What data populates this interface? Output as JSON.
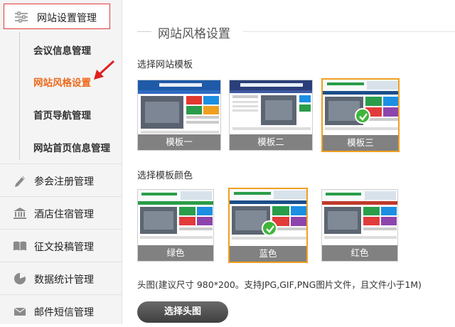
{
  "sidebar": {
    "top_item": {
      "label": "网站设置管理",
      "icon": "sliders-icon"
    },
    "sub_items": [
      {
        "label": "会议信息管理",
        "active": false
      },
      {
        "label": "网站风格设置",
        "active": true
      },
      {
        "label": "首页导航管理",
        "active": false
      },
      {
        "label": "网站首页信息管理",
        "active": false
      }
    ],
    "items": [
      {
        "label": "参会注册管理",
        "icon": "pencil-icon"
      },
      {
        "label": "酒店住宿管理",
        "icon": "bank-icon"
      },
      {
        "label": "征文投稿管理",
        "icon": "book-icon"
      },
      {
        "label": "数据统计管理",
        "icon": "pie-chart-icon"
      },
      {
        "label": "邮件短信管理",
        "icon": "mail-icon"
      }
    ]
  },
  "main": {
    "section_title": "网站风格设置",
    "template_label": "选择网站模板",
    "templates": [
      {
        "label": "模板一",
        "selected": false
      },
      {
        "label": "模板二",
        "selected": false
      },
      {
        "label": "模板三",
        "selected": true
      }
    ],
    "color_label": "选择模板颜色",
    "colors": [
      {
        "label": "绿色",
        "selected": false
      },
      {
        "label": "蓝色",
        "selected": true
      },
      {
        "label": "红色",
        "selected": false
      }
    ],
    "header_hint": "头图(建议尺寸 980*200。支持JPG,GIF,PNG图片文件，且文件小于1M)",
    "upload_button": "选择头图"
  },
  "colors": {
    "active_text": "#ee6a1c",
    "highlight_border": "#e23b3b",
    "selected_border": "#f0a020",
    "check_green": "#3fb63a"
  }
}
